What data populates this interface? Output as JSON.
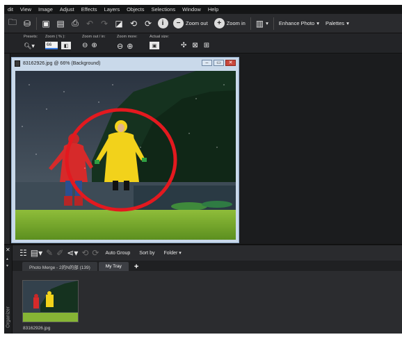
{
  "menu": [
    "dit",
    "View",
    "Image",
    "Adjust",
    "Effects",
    "Layers",
    "Objects",
    "Selections",
    "Window",
    "Help"
  ],
  "toolbar": {
    "zoom_out_label": "Zoom out",
    "zoom_in_label": "Zoom in",
    "enhance_label": "Enhance Photo",
    "palettes_label": "Palettes"
  },
  "options": {
    "presets_label": "Presets:",
    "zoom_percent_label": "Zoom ( % ):",
    "zoom_value": "66",
    "zoom_out_in_label": "Zoom out / in:",
    "zoom_more_label": "Zoom more:",
    "actual_size_label": "Actual size:"
  },
  "document": {
    "title": "83162926.jpg @ 66% (Background)"
  },
  "organizer": {
    "auto_group_label": "Auto Group",
    "sort_by_label": "Sort by",
    "folder_label": "Folder",
    "tabs": [
      "Photo Merge - 2的N的部 (139)",
      "My Tray"
    ],
    "add_tab": "+",
    "side_label": "Organizer",
    "thumbnail_name": "83162926.jpg"
  },
  "colors": {
    "app_bg": "#1e1f21",
    "doc_frame": "#c9d9ea",
    "highlight_circle": "#e3191f",
    "raincoat_yellow": "#f2d21b",
    "raincoat_red": "#d62a2a"
  }
}
